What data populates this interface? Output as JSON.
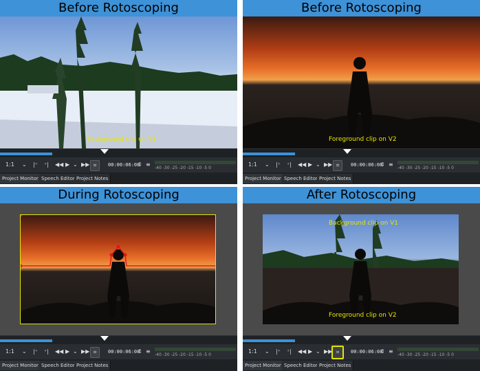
{
  "panels": [
    {
      "title": "Before Rotoscoping",
      "label": "Background clip on V1"
    },
    {
      "title": "Before Rotoscoping",
      "label": "Foreground clip on V2"
    },
    {
      "title": "During Rotoscoping"
    },
    {
      "title": "After Rotoscoping",
      "label_top": "Background clip on V1",
      "label_bottom": "Foreground clip on V2"
    }
  ],
  "toolbar": {
    "zoom": "1:1",
    "timecode": "00:00:06:08",
    "meter_ticks": "-40  -30 -25 -20 -15 -10  -5   0"
  },
  "tabs": [
    "Project Monitor",
    "Speech Editor",
    "Project Notes"
  ],
  "colors": {
    "accent": "#3d92d8",
    "label": "#e6e600",
    "panel_bg": "#232629"
  }
}
